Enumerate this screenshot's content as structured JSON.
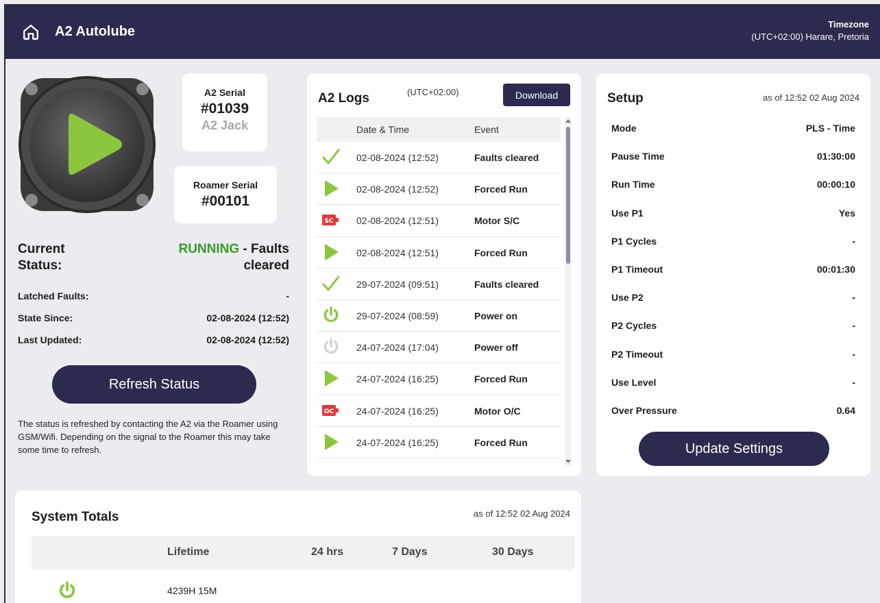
{
  "header": {
    "title": "A2 Autolube",
    "timezone_label": "Timezone",
    "timezone_value": "(UTC+02:00) Harare, Pretoria"
  },
  "device": {
    "a2_serial_label": "A2 Serial",
    "a2_serial": "#01039",
    "a2_name": "A2 Jack",
    "roamer_serial_label": "Roamer Serial",
    "roamer_serial": "#00101"
  },
  "status": {
    "current_label_1": "Current",
    "current_label_2": "Status:",
    "state": "RUNNING",
    "state_suffix_1": " - Faults",
    "state_suffix_2": "cleared",
    "latched_label": "Latched Faults:",
    "latched_value": "-",
    "since_label": "State Since:",
    "since_value": "02-08-2024 (12:52)",
    "updated_label": "Last Updated:",
    "updated_value": "02-08-2024 (12:52)",
    "refresh_button": "Refresh Status",
    "refresh_note": "The status is refreshed by contacting the A2 via the Roamer using GSM/Wifi. Depending on the signal to the Roamer this may take some time to refresh."
  },
  "logs": {
    "title": "A2 Logs",
    "timezone": "(UTC+02:00)",
    "download_button": "Download",
    "col_datetime": "Date & Time",
    "col_event": "Event",
    "rows": [
      {
        "icon": "check-icon",
        "datetime": "02-08-2024 (12:52)",
        "event": "Faults cleared"
      },
      {
        "icon": "play-icon",
        "datetime": "02-08-2024 (12:52)",
        "event": "Forced Run"
      },
      {
        "icon": "sc-icon",
        "datetime": "02-08-2024 (12:51)",
        "event": "Motor S/C"
      },
      {
        "icon": "play-icon",
        "datetime": "02-08-2024 (12:51)",
        "event": "Forced Run"
      },
      {
        "icon": "check-icon",
        "datetime": "29-07-2024 (09:51)",
        "event": "Faults cleared"
      },
      {
        "icon": "power-on-icon",
        "datetime": "29-07-2024 (08:59)",
        "event": "Power on"
      },
      {
        "icon": "power-off-icon",
        "datetime": "24-07-2024 (17:04)",
        "event": "Power off"
      },
      {
        "icon": "play-icon",
        "datetime": "24-07-2024 (16:25)",
        "event": "Forced Run"
      },
      {
        "icon": "oc-icon",
        "datetime": "24-07-2024 (16:25)",
        "event": "Motor O/C"
      },
      {
        "icon": "play-icon",
        "datetime": "24-07-2024 (16:25)",
        "event": "Forced Run"
      }
    ]
  },
  "setup": {
    "title": "Setup",
    "as_of": "as of 12:52 02 Aug 2024",
    "rows": [
      {
        "label": "Mode",
        "value": "PLS - Time"
      },
      {
        "label": "Pause Time",
        "value": "01:30:00"
      },
      {
        "label": "Run Time",
        "value": "00:00:10"
      },
      {
        "label": "Use P1",
        "value": "Yes"
      },
      {
        "label": "P1 Cycles",
        "value": "-"
      },
      {
        "label": "P1 Timeout",
        "value": "00:01:30"
      },
      {
        "label": "Use P2",
        "value": "-"
      },
      {
        "label": "P2 Cycles",
        "value": "-"
      },
      {
        "label": "P2 Timeout",
        "value": "-"
      },
      {
        "label": "Use Level",
        "value": "-"
      },
      {
        "label": "Over Pressure",
        "value": "0.64"
      }
    ],
    "update_button": "Update Settings"
  },
  "totals": {
    "title": "System Totals",
    "as_of": "as of 12:52 02 Aug 2024",
    "col_lifetime": "Lifetime",
    "col_24h": "24 hrs",
    "col_7d": "7 Days",
    "col_30d": "30 Days",
    "power_lifetime": "4239H 15M"
  },
  "colors": {
    "header_bg": "#2c2a4f",
    "accent_green": "#8cc63f",
    "running_green": "#3a9c2a",
    "fault_red": "#e03c3c"
  }
}
